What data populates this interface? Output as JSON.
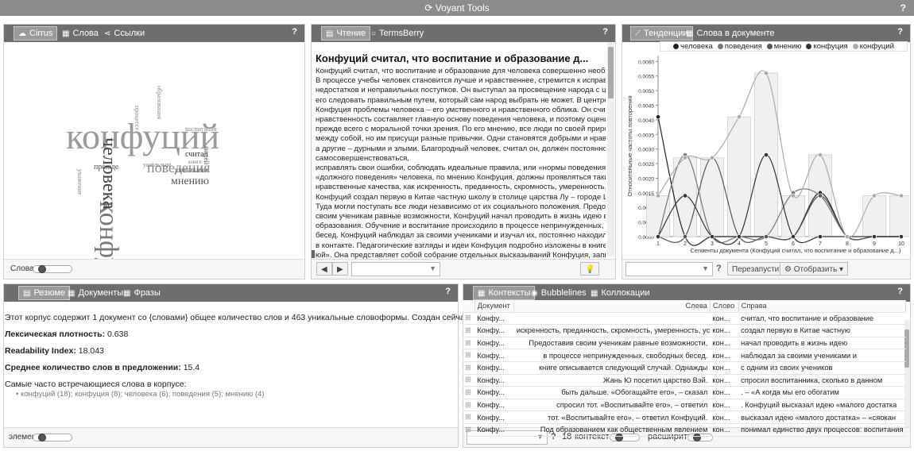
{
  "app": {
    "title": "Voyant Tools",
    "help": "?"
  },
  "cirrus_panel": {
    "tabs": [
      "Cirrus",
      "Слова",
      "Ссылки"
    ],
    "help": "?",
    "footer_label": "Слова:",
    "words": [
      {
        "text": "конфуций"
      },
      {
        "text": "конфуция"
      },
      {
        "text": "человека"
      },
      {
        "text": "поведения"
      },
      {
        "text": "мнению"
      },
      {
        "text": "считал"
      },
      {
        "text": "прежде"
      },
      {
        "text": "людей"
      },
      {
        "text": "учениками"
      },
      {
        "text": "воспитания"
      },
      {
        "text": "образования"
      },
      {
        "text": "процессе"
      },
      {
        "text": "уважение"
      },
      {
        "text": "ушёльзым"
      },
      {
        "text": "книге"
      }
    ]
  },
  "reader_panel": {
    "tabs": [
      "Чтение",
      "TermsBerry"
    ],
    "help": "?",
    "title": "Конфуций считал, что воспитание и образование д...",
    "lines": [
      "Конфуций считал, что воспитание и образование для человека совершенно необходимы.",
      "В процессе учебы человек становится лучше и нравственнее, стремится к исправлению",
      "недостатков и неправильных поступков. Он выступал за просвещение народа с целью заставить",
      "его следовать правильным путем, который сам народ выбрать не может. В центре внимания",
      "Конфуция проблемы человека – его умственного и нравственного облика. Он считал, что",
      "нравственность составляет главную основу поведения человека, и поэтому оценивал людей",
      "прежде всего с моральной точки зрения. По его мнению, все люди по своей природе близки",
      "между собой, но им присущи разные привычки. Одни становятся добрыми и нравственными,",
      "а другие – дурными и злыми. Благородный человек, считал он, должен постоянно",
      "самосовершенствоваться,",
      "исправлять свои ошибки, соблюдать идеальные правила, или «нормы поведения». А в принципах",
      "«должного поведения» человека, по мнению Конфуция, должны проявляться такие высокие",
      "нравственные качества, как искренность, преданность, скромность, умеренность, уступчивость.",
      "Конфуций создал первую в Китае частную школу в столице царства Лу – городе Цюйфу.",
      "Туда могли поступать все люди независимо от их социального положения. Предоставив",
      "своим ученикам равные возможности, Конфуций начал проводить в жизнь идею всеобщего",
      "образования. Обучение и воспитание происходило в процессе непринужденных, свободных",
      "бесед. Конфуций наблюдал за своими учениками и изучал их, постоянно находился с ними",
      "в контакте. Педагогические взгляды и идеи Конфуция подробно изложены в книге «Луньи",
      "юй». Она представляет собой собрание отдельных высказываний Конфуция, записанных его"
    ]
  },
  "trends_panel": {
    "tabs": [
      "Тенденции",
      "Слова в документе"
    ],
    "help": "?",
    "buttons": {
      "restart": "Перезапустить",
      "display": "Отобразить"
    },
    "combo_help": "?"
  },
  "summary_panel": {
    "tabs": [
      "Резюме",
      "Документы",
      "Фразы"
    ],
    "help": "?",
    "intro": "Этот корпус содержит 1 документ со {словами} общее количество слов и 463 уникальные словоформы. Создан сейчас.",
    "lexical_label": "Лексическая плотность:",
    "lexical_value": "0.638",
    "readability_label": "Readability Index:",
    "readability_value": "18.043",
    "avg_label": "Среднее количество слов в предложении:",
    "avg_value": "15.4",
    "frequent_label": "Самые часто встречающиеся слова в корпусе:",
    "frequent_list": "конфуций (18); конфуция (8); человека (6); поведения (5); мнению (4)",
    "footer_label": "элемен"
  },
  "contexts_panel": {
    "tabs": [
      "Контексты",
      "Bubblelines",
      "Коллокации"
    ],
    "help": "?",
    "columns": [
      "Документ",
      "Слева",
      "Слово",
      "Справа"
    ],
    "rows": [
      {
        "doc": "Конфу...",
        "left": "",
        "word": "кон...",
        "right": "считал, что воспитание и образование"
      },
      {
        "doc": "Конфу...",
        "left": "искренность, преданность, скромность, умеренность, усту...",
        "word": "кон...",
        "right": "создал первую в Китае частную"
      },
      {
        "doc": "Конфу...",
        "left": "Предоставив своим ученикам равные возможности,",
        "word": "кон...",
        "right": "начал проводить в жизнь идею"
      },
      {
        "doc": "Конфу...",
        "left": "в процессе непринужденных, свободных бесед.",
        "word": "кон...",
        "right": "наблюдал за своими учениками и"
      },
      {
        "doc": "Конфу...",
        "left": "книге описывается следующий случай. Однажды",
        "word": "кон...",
        "right": "с одним из своих учеников"
      },
      {
        "doc": "Конфу...",
        "left": "Жань Ю посетил царство Вэй.",
        "word": "кон...",
        "right": "спросил воспитанника, сколько в данном"
      },
      {
        "doc": "Конфу...",
        "left": "быть дальше. «Обогащайте его», – сказал",
        "word": "кон...",
        "right": ". – «А когда мы его обогатим"
      },
      {
        "doc": "Конфу...",
        "left": "спросил тот. «Воспитывайте его», – ответил",
        "word": "кон...",
        "right": ". Конфуций высказал идею «малого достатка"
      },
      {
        "doc": "Конфу...",
        "left": "тот. «Воспитывайте его», – ответил Конфуций.",
        "word": "кон...",
        "right": "высказал идею «малого достатка» – «сяокан"
      },
      {
        "doc": "Конфу...",
        "left": "Под образованием как общественным явлением",
        "word": "кон...",
        "right": "понимал единство двух процессов: воспитания"
      }
    ],
    "footer": {
      "help": "?",
      "count": "18",
      "context_label": "контекст",
      "expand_label": "расширить"
    }
  },
  "chart_data": {
    "type": "line",
    "title": "",
    "xlabel": "Сегменты документа (Конфуций считал, что воспитание и образование д...)",
    "ylabel": "Относительные частоты повторения",
    "x": [
      1,
      2,
      3,
      4,
      5,
      6,
      7,
      8,
      9,
      10
    ],
    "xlim": [
      1,
      10
    ],
    "ylim": [
      0,
      0.0062
    ],
    "yticks": [
      "0.0000",
      "0.0005",
      "0.0010",
      "0.0015",
      "0.0020",
      "0.0025",
      "0.0030",
      "0.0035",
      "0.0040",
      "0.0045",
      "0.0050",
      "0.0055",
      "0.0060"
    ],
    "legend_position": "top",
    "series": [
      {
        "name": "человека",
        "color": "#222222",
        "values": [
          0.0041,
          0,
          0,
          0,
          0,
          0,
          0.0015,
          0,
          0,
          0
        ]
      },
      {
        "name": "поведения",
        "color": "#777777",
        "values": [
          0,
          0.0028,
          0,
          0,
          0,
          0.0015,
          0.0014,
          0,
          0,
          0
        ]
      },
      {
        "name": "мнению",
        "color": "#555555",
        "values": [
          0,
          0,
          0.0027,
          0,
          0,
          0,
          0.0014,
          0,
          0,
          0
        ]
      },
      {
        "name": "конфуция",
        "color": "#333333",
        "values": [
          0,
          0.0014,
          0,
          0,
          0.0028,
          0,
          0,
          0,
          0,
          0
        ]
      },
      {
        "name": "конфуций",
        "color": "#aaaaaa",
        "values": [
          0.0014,
          0.0027,
          0.0027,
          0.0041,
          0.0056,
          0.0014,
          0.0028,
          0,
          0.0014,
          0.0014
        ]
      }
    ],
    "bars": {
      "series": "конфуций",
      "values": [
        0.0014,
        0.0027,
        0.0027,
        0.0041,
        0.0056,
        0.0014,
        0.0028,
        0,
        0.0014,
        0.0014
      ]
    }
  }
}
